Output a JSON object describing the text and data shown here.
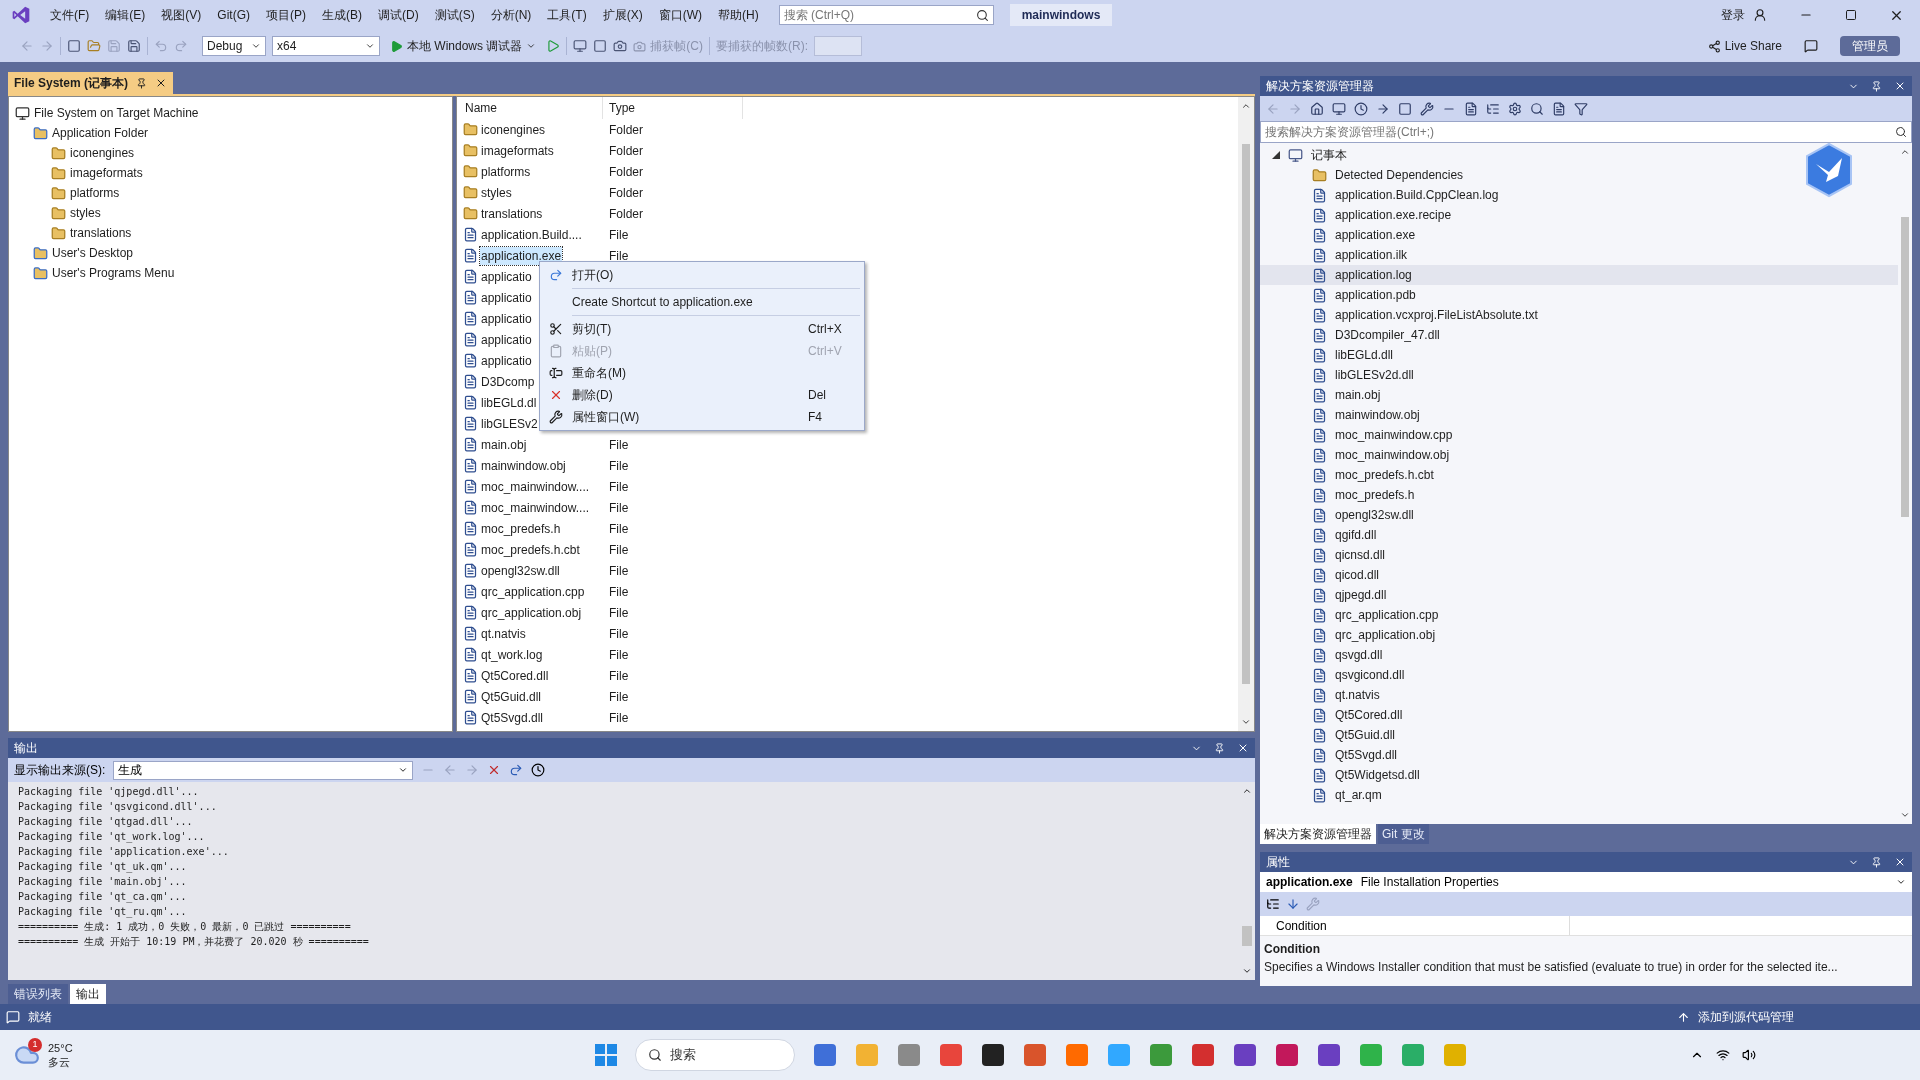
{
  "menu": [
    "文件(F)",
    "编辑(E)",
    "视图(V)",
    "Git(G)",
    "项目(P)",
    "生成(B)",
    "调试(D)",
    "测试(S)",
    "分析(N)",
    "工具(T)",
    "扩展(X)",
    "窗口(W)",
    "帮助(H)"
  ],
  "search": {
    "placeholder": "搜索 (Ctrl+Q)"
  },
  "solution_name": "mainwindows",
  "sign_in": "登录",
  "toolbar": {
    "configuration": "Debug",
    "platform": "x64",
    "debugger": "本地 Windows 调试器",
    "capture": "捕获帧(C)",
    "frames_label": "要捕获的帧数(R):",
    "live_share": "Live Share",
    "admin": "管理员"
  },
  "file_system": {
    "tab": "File System (记事本)",
    "tree": [
      {
        "label": "File System on Target Machine",
        "kind": "machine",
        "children": [
          {
            "label": "Application Folder",
            "kind": "special",
            "children": [
              {
                "label": "iconengines",
                "kind": "folder"
              },
              {
                "label": "imageformats",
                "kind": "folder"
              },
              {
                "label": "platforms",
                "kind": "folder"
              },
              {
                "label": "styles",
                "kind": "folder"
              },
              {
                "label": "translations",
                "kind": "folder"
              }
            ]
          },
          {
            "label": "User's Desktop",
            "kind": "special"
          },
          {
            "label": "User's Programs Menu",
            "kind": "special"
          }
        ]
      }
    ],
    "columns": [
      "Name",
      "Type"
    ],
    "rows": [
      {
        "name": "iconengines",
        "type": "Folder",
        "kind": "folder",
        "selected": false
      },
      {
        "name": "imageformats",
        "type": "Folder",
        "kind": "folder",
        "selected": false
      },
      {
        "name": "platforms",
        "type": "Folder",
        "kind": "folder",
        "selected": false
      },
      {
        "name": "styles",
        "type": "Folder",
        "kind": "folder",
        "selected": false
      },
      {
        "name": "translations",
        "type": "Folder",
        "kind": "folder",
        "selected": false
      },
      {
        "name": "application.Build....",
        "type": "File",
        "kind": "file",
        "selected": false
      },
      {
        "name": "application.exe",
        "type": "File",
        "kind": "file",
        "selected": true
      },
      {
        "name": "applicatio",
        "kind": "file",
        "selected": false
      },
      {
        "name": "applicatio",
        "kind": "file",
        "selected": false
      },
      {
        "name": "applicatio",
        "kind": "file",
        "selected": false
      },
      {
        "name": "applicatio",
        "kind": "file",
        "selected": false
      },
      {
        "name": "applicatio",
        "kind": "file",
        "selected": false
      },
      {
        "name": "D3Dcomp",
        "kind": "file",
        "selected": false
      },
      {
        "name": "libEGLd.dl",
        "kind": "file",
        "selected": false
      },
      {
        "name": "libGLESv2",
        "kind": "file",
        "selected": false
      },
      {
        "name": "main.obj",
        "type": "File",
        "kind": "file",
        "selected": false
      },
      {
        "name": "mainwindow.obj",
        "type": "File",
        "kind": "file",
        "selected": false
      },
      {
        "name": "moc_mainwindow....",
        "type": "File",
        "kind": "file",
        "selected": false
      },
      {
        "name": "moc_mainwindow....",
        "type": "File",
        "kind": "file",
        "selected": false
      },
      {
        "name": "moc_predefs.h",
        "type": "File",
        "kind": "file",
        "selected": false
      },
      {
        "name": "moc_predefs.h.cbt",
        "type": "File",
        "kind": "file",
        "selected": false
      },
      {
        "name": "opengl32sw.dll",
        "type": "File",
        "kind": "file",
        "selected": false
      },
      {
        "name": "qrc_application.cpp",
        "type": "File",
        "kind": "file",
        "selected": false
      },
      {
        "name": "qrc_application.obj",
        "type": "File",
        "kind": "file",
        "selected": false
      },
      {
        "name": "qt.natvis",
        "type": "File",
        "kind": "file",
        "selected": false
      },
      {
        "name": "qt_work.log",
        "type": "File",
        "kind": "file",
        "selected": false
      },
      {
        "name": "Qt5Cored.dll",
        "type": "File",
        "kind": "file",
        "selected": false
      },
      {
        "name": "Qt5Guid.dll",
        "type": "File",
        "kind": "file",
        "selected": false
      },
      {
        "name": "Qt5Svgd.dll",
        "type": "File",
        "kind": "file",
        "selected": false
      }
    ]
  },
  "context_menu": [
    {
      "kind": "item",
      "label": "打开(O)",
      "disabled": false
    },
    {
      "kind": "separator"
    },
    {
      "kind": "item",
      "label": "Create Shortcut to application.exe",
      "disabled": false
    },
    {
      "kind": "separator"
    },
    {
      "kind": "item",
      "label": "剪切(T)",
      "shortcut": "Ctrl+X",
      "disabled": false
    },
    {
      "kind": "item",
      "label": "粘贴(P)",
      "shortcut": "Ctrl+V",
      "disabled": true
    },
    {
      "kind": "item",
      "label": "重命名(M)",
      "disabled": false
    },
    {
      "kind": "item",
      "label": "删除(D)",
      "shortcut": "Del",
      "disabled": false
    },
    {
      "kind": "item",
      "label": "属性窗口(W)",
      "shortcut": "F4",
      "disabled": false
    }
  ],
  "output": {
    "title": "输出",
    "source_label": "显示输出来源(S):",
    "source": "生成",
    "lines": [
      "Packaging file 'qjpegd.dll'...",
      "Packaging file 'qsvgicond.dll'...",
      "Packaging file 'qtgad.dll'...",
      "Packaging file 'qt_work.log'...",
      "Packaging file 'application.exe'...",
      "Packaging file 'qt_uk.qm'...",
      "Packaging file 'main.obj'...",
      "Packaging file 'qt_ca.qm'...",
      "Packaging file 'qt_ru.qm'...",
      "========== 生成: 1 成功，0 失败，0 最新，0 已跳过 ==========",
      "========== 生成 开始于 10:19 PM，并花费了 20.020 秒 =========="
    ],
    "tabs": [
      {
        "label": "错误列表",
        "selected": false
      },
      {
        "label": "输出",
        "selected": true
      }
    ]
  },
  "solution_explorer": {
    "title": "解决方案资源管理器",
    "search_placeholder": "搜索解决方案资源管理器(Ctrl+;)",
    "root": {
      "label": "记事本",
      "expanded": true,
      "children": [
        {
          "label": "Detected Dependencies",
          "kind": "folder",
          "selected": false
        },
        {
          "label": "application.Build.CppClean.log",
          "kind": "file",
          "selected": false
        },
        {
          "label": "application.exe.recipe",
          "kind": "file",
          "selected": false
        },
        {
          "label": "application.exe",
          "kind": "file",
          "selected": false
        },
        {
          "label": "application.ilk",
          "kind": "file",
          "selected": false
        },
        {
          "label": "application.log",
          "kind": "file",
          "selected": true
        },
        {
          "label": "application.pdb",
          "kind": "file",
          "selected": false
        },
        {
          "label": "application.vcxproj.FileListAbsolute.txt",
          "kind": "file",
          "selected": false
        },
        {
          "label": "D3Dcompiler_47.dll",
          "kind": "file",
          "selected": false
        },
        {
          "label": "libEGLd.dll",
          "kind": "file",
          "selected": false
        },
        {
          "label": "libGLESv2d.dll",
          "kind": "file",
          "selected": false
        },
        {
          "label": "main.obj",
          "kind": "file",
          "selected": false
        },
        {
          "label": "mainwindow.obj",
          "kind": "file",
          "selected": false
        },
        {
          "label": "moc_mainwindow.cpp",
          "kind": "file",
          "selected": false
        },
        {
          "label": "moc_mainwindow.obj",
          "kind": "file",
          "selected": false
        },
        {
          "label": "moc_predefs.h.cbt",
          "kind": "file",
          "selected": false
        },
        {
          "label": "moc_predefs.h",
          "kind": "file",
          "selected": false
        },
        {
          "label": "opengl32sw.dll",
          "kind": "file",
          "selected": false
        },
        {
          "label": "qgifd.dll",
          "kind": "file",
          "selected": false
        },
        {
          "label": "qicnsd.dll",
          "kind": "file",
          "selected": false
        },
        {
          "label": "qicod.dll",
          "kind": "file",
          "selected": false
        },
        {
          "label": "qjpegd.dll",
          "kind": "file",
          "selected": false
        },
        {
          "label": "qrc_application.cpp",
          "kind": "file",
          "selected": false
        },
        {
          "label": "qrc_application.obj",
          "kind": "file",
          "selected": false
        },
        {
          "label": "qsvgd.dll",
          "kind": "file",
          "selected": false
        },
        {
          "label": "qsvgicond.dll",
          "kind": "file",
          "selected": false
        },
        {
          "label": "qt.natvis",
          "kind": "file",
          "selected": false
        },
        {
          "label": "Qt5Cored.dll",
          "kind": "file",
          "selected": false
        },
        {
          "label": "Qt5Guid.dll",
          "kind": "file",
          "selected": false
        },
        {
          "label": "Qt5Svgd.dll",
          "kind": "file",
          "selected": false
        },
        {
          "label": "Qt5Widgetsd.dll",
          "kind": "file",
          "selected": false
        },
        {
          "label": "qt_ar.qm",
          "kind": "file",
          "selected": false
        }
      ]
    },
    "tabs": [
      {
        "label": "解决方案资源管理器",
        "selected": true
      },
      {
        "label": "Git 更改",
        "selected": false
      }
    ]
  },
  "properties": {
    "title": "属性",
    "object": "application.exe",
    "object_type": "File Installation Properties",
    "rows": [
      {
        "name": "Condition"
      }
    ],
    "description_title": "Condition",
    "description": "Specifies a Windows Installer condition that must be satisfied (evaluate to true) in order for the selected ite..."
  },
  "status_bar": {
    "text": "就绪",
    "source_control": "添加到源代码管理"
  },
  "taskbar": {
    "temperature": "25°C",
    "weather": "多云",
    "badge": "1",
    "search": "搜索"
  }
}
